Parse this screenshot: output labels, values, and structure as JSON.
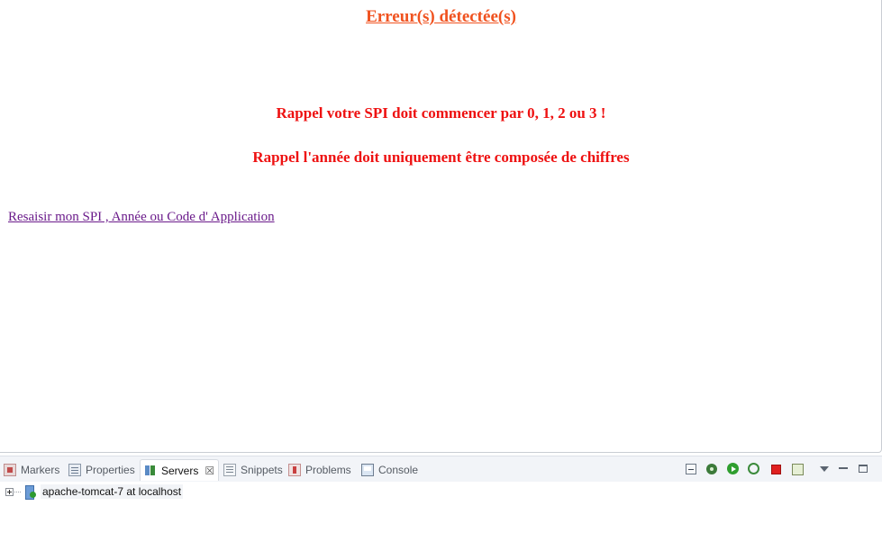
{
  "page": {
    "title": "Erreur(s) détectée(s)",
    "messages": [
      "Rappel votre SPI doit commencer par 0, 1, 2 ou 3 !",
      "Rappel l'année doit uniquement être composée de chiffres"
    ],
    "link_text": "Resaisir mon SPI , Année ou Code d' Application"
  },
  "panel": {
    "tabs": [
      {
        "label": "Markers",
        "icon": "markers-icon",
        "active": false
      },
      {
        "label": "Properties",
        "icon": "properties-icon",
        "active": false
      },
      {
        "label": "Servers",
        "icon": "servers-icon",
        "active": true
      },
      {
        "label": "Snippets",
        "icon": "snippets-icon",
        "active": false
      },
      {
        "label": "Problems",
        "icon": "problems-icon",
        "active": false
      },
      {
        "label": "Console",
        "icon": "console-icon",
        "active": false
      }
    ],
    "close_glyph": "☒",
    "toolbar": [
      "collapse-all-icon",
      "debug-icon",
      "start-icon",
      "profile-icon",
      "stop-icon",
      "publish-icon",
      "view-menu-icon",
      "minimize-icon",
      "maximize-icon"
    ],
    "server_entry": "apache-tomcat-7 at localhost"
  },
  "colors": {
    "title": "#f0521f",
    "error_text": "#ee1111",
    "link": "#6a1a8a"
  }
}
